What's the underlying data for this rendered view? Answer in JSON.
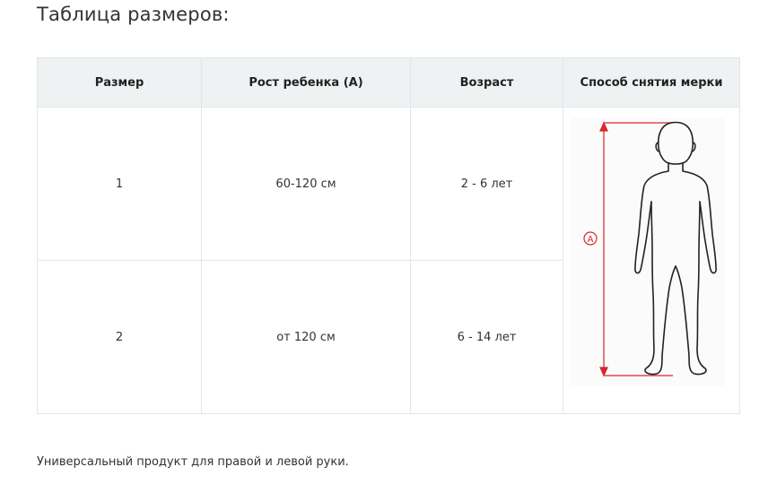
{
  "title": "Таблица размеров:",
  "table": {
    "headers": [
      "Размер",
      "Рост ребенка (А)",
      "Возраст",
      "Способ снятия мерки"
    ],
    "rows": [
      {
        "size": "1",
        "height": "60-120 см",
        "age": "2 - 6 лет"
      },
      {
        "size": "2",
        "height": "от 120 см",
        "age": "6 - 14 лет"
      }
    ],
    "figure_label": "A"
  },
  "note": "Универсальный продукт для правой и левой руки."
}
